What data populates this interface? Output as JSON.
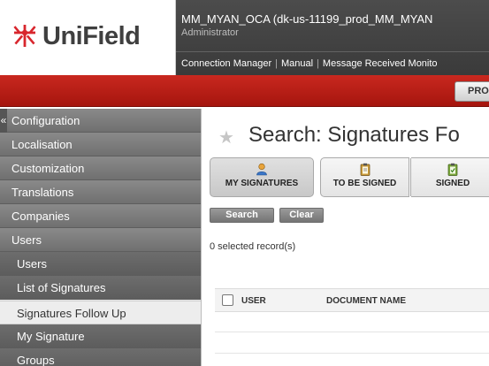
{
  "brand": {
    "logo_text": "UniField",
    "logo_color": "#d8262d"
  },
  "header": {
    "db_name": "MM_MYAN_OCA (dk-us-11199_prod_MM_MYAN",
    "user_role": "Administrator",
    "links": [
      "Connection Manager",
      "Manual",
      "Message Received Monito"
    ]
  },
  "redbar": {
    "button_label": "PRO"
  },
  "sidebar": {
    "collapse_glyph": "«",
    "items": [
      {
        "label": "Configuration"
      },
      {
        "label": "Localisation"
      },
      {
        "label": "Customization"
      },
      {
        "label": "Translations"
      },
      {
        "label": "Companies"
      },
      {
        "label": "Users"
      }
    ],
    "sub_items": [
      {
        "label": "Users"
      },
      {
        "label": "List of Signatures"
      },
      {
        "label": "Signatures Follow Up",
        "active": true
      },
      {
        "label": "My Signature"
      },
      {
        "label": "Groups"
      }
    ]
  },
  "main": {
    "title": "Search: Signatures Fo",
    "filters": [
      {
        "label": "MY SIGNATURES",
        "icon": "user-icon",
        "active": true
      },
      {
        "label": "TO BE SIGNED",
        "icon": "clipboard-icon"
      },
      {
        "label": "SIGNED",
        "icon": "clipboard-check-icon"
      }
    ],
    "search_label": "Search",
    "clear_label": "Clear",
    "selected_count": "0 selected record(s)",
    "columns": [
      "USER",
      "DOCUMENT NAME"
    ]
  }
}
